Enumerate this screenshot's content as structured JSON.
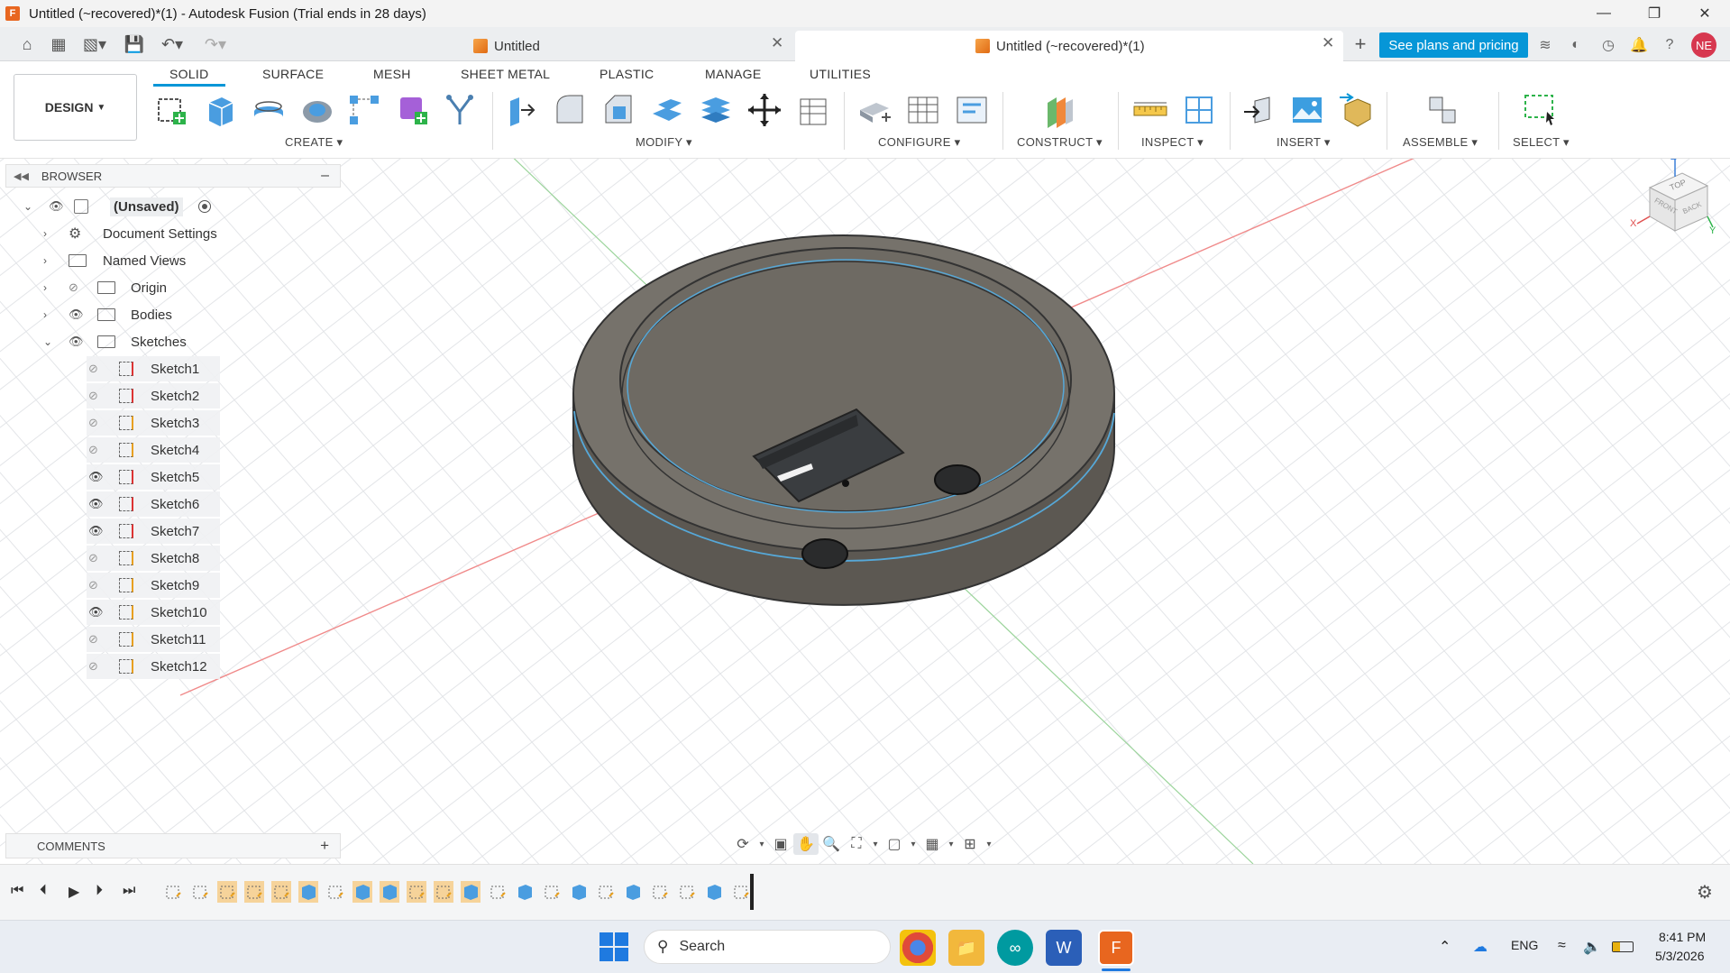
{
  "window": {
    "title": "Untitled (~recovered)*(1) - Autodesk Fusion (Trial ends in 28 days)",
    "app_logo": "F"
  },
  "tabs": [
    {
      "label": "Untitled",
      "active": false
    },
    {
      "label": "Untitled (~recovered)*(1)",
      "active": true
    }
  ],
  "plans_button": "See plans and pricing",
  "avatar_initials": "NE",
  "workspace_button": "DESIGN",
  "ribbon_tabs": [
    "SOLID",
    "SURFACE",
    "MESH",
    "SHEET METAL",
    "PLASTIC",
    "MANAGE",
    "UTILITIES"
  ],
  "ribbon_groups": [
    "CREATE",
    "MODIFY",
    "CONFIGURE",
    "CONSTRUCT",
    "INSPECT",
    "INSERT",
    "ASSEMBLE",
    "SELECT"
  ],
  "browser": {
    "title": "BROWSER",
    "root": "(Unsaved)",
    "items": [
      "Document Settings",
      "Named Views",
      "Origin",
      "Bodies",
      "Sketches"
    ],
    "sketches": [
      {
        "label": "Sketch1",
        "visible": false
      },
      {
        "label": "Sketch2",
        "visible": false
      },
      {
        "label": "Sketch3",
        "visible": false
      },
      {
        "label": "Sketch4",
        "visible": false
      },
      {
        "label": "Sketch5",
        "visible": true
      },
      {
        "label": "Sketch6",
        "visible": true
      },
      {
        "label": "Sketch7",
        "visible": true
      },
      {
        "label": "Sketch8",
        "visible": false
      },
      {
        "label": "Sketch9",
        "visible": false
      },
      {
        "label": "Sketch10",
        "visible": true
      },
      {
        "label": "Sketch11",
        "visible": false
      },
      {
        "label": "Sketch12",
        "visible": false
      }
    ]
  },
  "comments_label": "COMMENTS",
  "viewcube": {
    "top": "TOP",
    "front": "FRONT",
    "back": "BACK",
    "axis_z": "Z",
    "axis_x": "X",
    "axis_y": "Y"
  },
  "taskbar": {
    "search_placeholder": "Search",
    "language": "ENG",
    "time": "8:41 PM",
    "date": "5/3/2026"
  },
  "colors": {
    "accent": "#0696d7",
    "model": "#6e6a63",
    "timeline_highlight": "#f6d39a"
  }
}
